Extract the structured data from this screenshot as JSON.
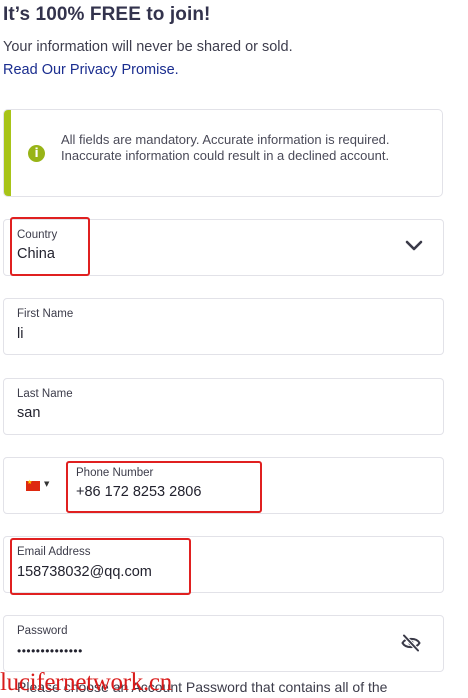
{
  "header": {
    "title": "It’s 100% FREE to join!",
    "subtitle": "Your information will never be shared or sold.",
    "privacy_link": "Read Our Privacy Promise."
  },
  "notice": {
    "icon": "info-icon",
    "text": "All fields are mandatory. Accurate information is required. Inaccurate information could result in a declined account.",
    "accent_color": "#a8c418"
  },
  "form": {
    "country": {
      "label": "Country",
      "value": "China",
      "icon": "chevron-down-icon"
    },
    "first_name": {
      "label": "First Name",
      "value": "li"
    },
    "last_name": {
      "label": "Last Name",
      "value": "san"
    },
    "phone": {
      "label": "Phone Number",
      "value": "+86 172 8253 2806",
      "flag_icon": "china-flag-icon"
    },
    "email": {
      "label": "Email Address",
      "value": "158738032@qq.com"
    },
    "password": {
      "label": "Password",
      "value": "••••••••••••••",
      "icon": "eye-slash-icon"
    }
  },
  "password_hint": "Please choose an Account Password that contains all of the",
  "watermark": "lucifernetwork.cn",
  "annotation_color": "#e02020"
}
